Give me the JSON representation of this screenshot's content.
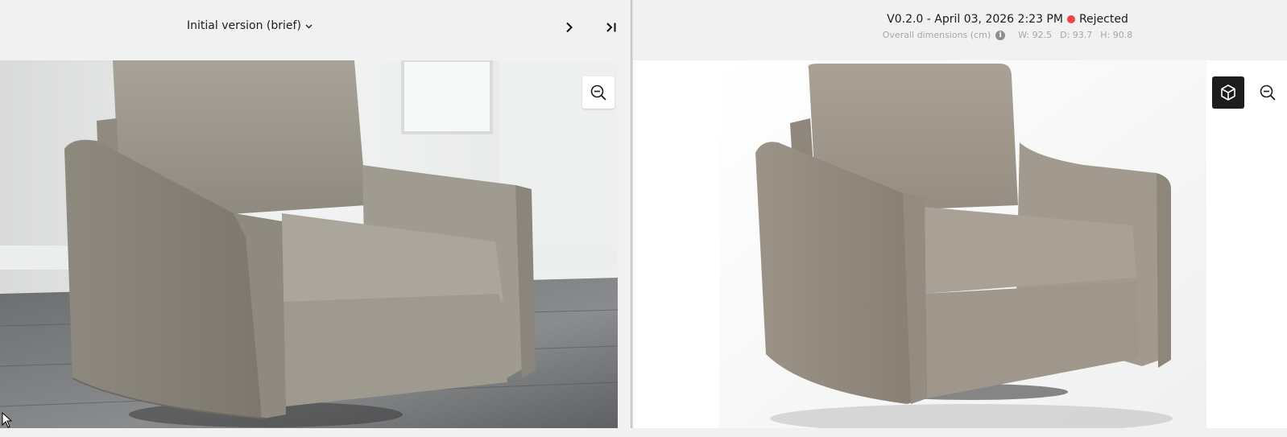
{
  "left_pane": {
    "version_label": "Initial version (brief)",
    "photo": "armchair-room-photo"
  },
  "right_pane": {
    "version": "V0.2.0 - April 03, 2026 2:23 PM",
    "status": "Rejected",
    "status_color": "#f04545",
    "dimensions_label": "Overall dimensions (cm)",
    "width": "W: 92.5",
    "depth": "D: 93.7",
    "height": "H: 90.8",
    "render": "armchair-3d-render"
  },
  "icons": {
    "chevron_down": "chevron-down-icon",
    "next": "chevron-right-icon",
    "last": "skip-to-last-icon",
    "zoom": "zoom-out-icon",
    "cube": "cube-3d-icon",
    "info": "info-icon"
  }
}
